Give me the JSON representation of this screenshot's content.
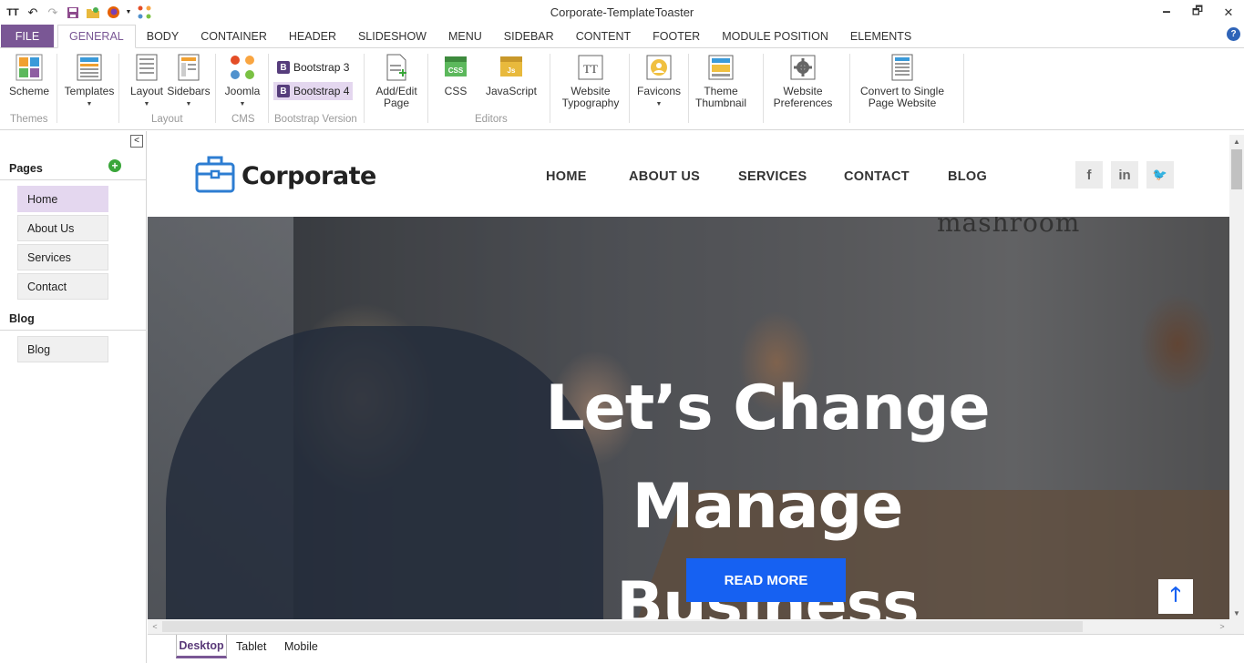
{
  "window": {
    "title": "Corporate-TemplateToaster",
    "qat_icons": [
      "tt-logo-icon",
      "undo-icon",
      "redo-icon",
      "save-icon",
      "open-folder-icon",
      "firefox-icon",
      "dropdown-icon",
      "joomla-icon"
    ],
    "controls": {
      "minimize": "🗕",
      "restore": "🗗",
      "close": "✕"
    }
  },
  "menu_tabs": {
    "file": "FILE",
    "items": [
      "GENERAL",
      "BODY",
      "CONTAINER",
      "HEADER",
      "SLIDESHOW",
      "MENU",
      "SIDEBAR",
      "CONTENT",
      "FOOTER",
      "MODULE POSITION",
      "ELEMENTS"
    ],
    "active": "GENERAL",
    "help": "?"
  },
  "ribbon": {
    "scheme": "Scheme",
    "templates": "Templates",
    "layout": "Layout",
    "sidebars": "Sidebars",
    "joomla": "Joomla",
    "bootstrap3": "Bootstrap 3",
    "bootstrap4": "Bootstrap 4",
    "bs_badge": "B",
    "addedit_line1": "Add/Edit",
    "addedit_line2": "Page",
    "css": "CSS",
    "javascript": "JavaScript",
    "typography_line1": "Website",
    "typography_line2": "Typography",
    "favicons": "Favicons",
    "thumb_line1": "Theme",
    "thumb_line2": "Thumbnail",
    "prefs_line1": "Website",
    "prefs_line2": "Preferences",
    "convert_line1": "Convert to Single",
    "convert_line2": "Page Website",
    "groups": {
      "themes": "Themes",
      "layout": "Layout",
      "cms": "CMS",
      "bootstrap": "Bootstrap Version",
      "editors": "Editors"
    }
  },
  "left_panel": {
    "pages_title": "Pages",
    "add": "+",
    "collapse": "<",
    "pages": [
      "Home",
      "About Us",
      "Services",
      "Contact"
    ],
    "selected_page": "Home",
    "blog_title": "Blog",
    "blog_pages": [
      "Blog"
    ]
  },
  "site": {
    "logo_text": "Corporate",
    "nav": [
      "HOME",
      "ABOUT US",
      "SERVICES",
      "CONTACT",
      "BLOG"
    ],
    "social": [
      "f",
      "in",
      "🐦"
    ],
    "hero_line1": "Let’s Change Manage",
    "hero_line2": "Business",
    "sign_text": "mashroom",
    "read_more": "READ MORE",
    "to_top": "🡑"
  },
  "device_tabs": {
    "items": [
      "Desktop",
      "Tablet",
      "Mobile"
    ],
    "active": "Desktop"
  },
  "colors": {
    "file_tab": "#7a5795",
    "accent": "#7a5795",
    "selected_bg": "#e4d7ef",
    "read_more": "#1661f2",
    "add_button": "#3aa63a"
  }
}
